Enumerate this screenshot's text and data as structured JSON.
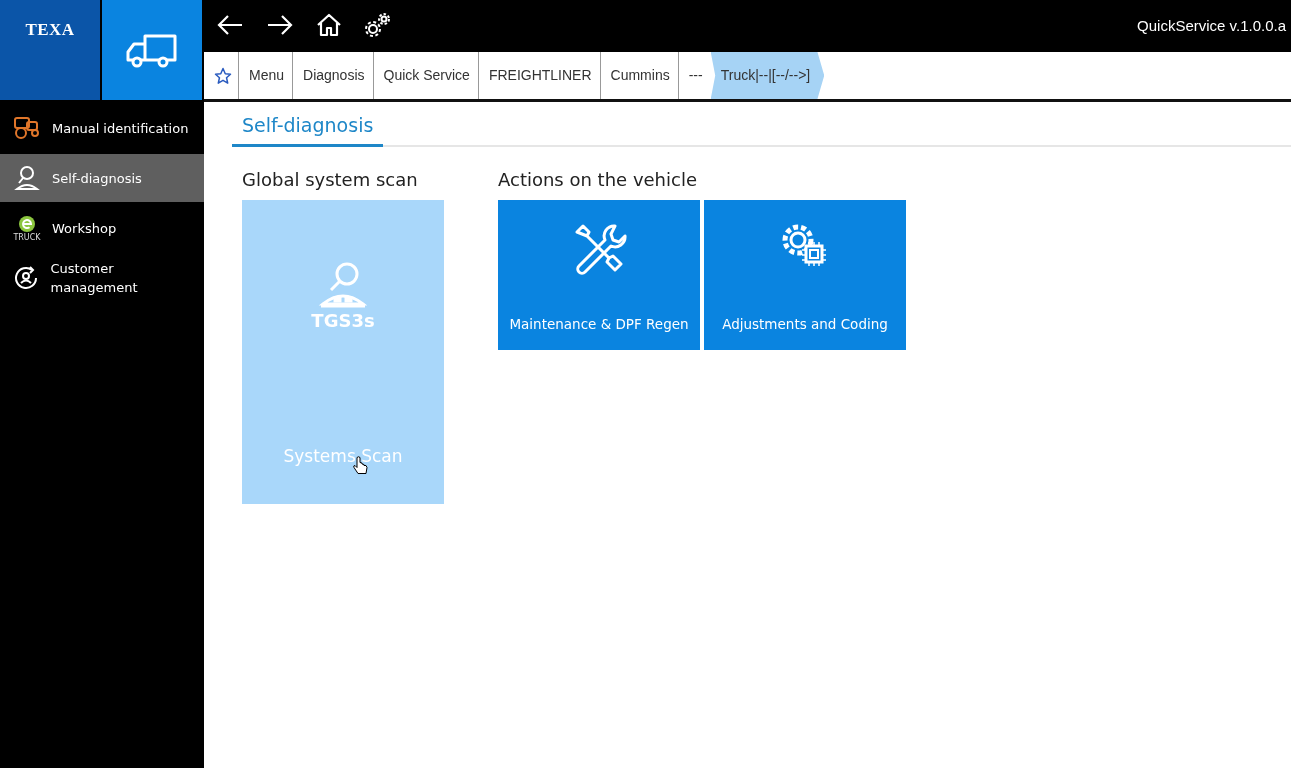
{
  "logo": {
    "text": "TEXA"
  },
  "app_title": "QuickService v.1.0.0.a",
  "breadcrumb": [
    {
      "label": "Menu",
      "selected": false
    },
    {
      "label": "Diagnosis",
      "selected": false
    },
    {
      "label": "Quick Service",
      "selected": false
    },
    {
      "label": "FREIGHTLINER",
      "selected": false
    },
    {
      "label": "Cummins",
      "selected": false
    },
    {
      "label": "---",
      "selected": false
    },
    {
      "label": "Truck|--|[--/-->]",
      "selected": true
    }
  ],
  "sidebar": {
    "items": [
      {
        "label": "Manual identification",
        "selected": false
      },
      {
        "label": "Self-diagnosis",
        "selected": true
      },
      {
        "label": "Workshop",
        "selected": false,
        "icon_caption": "TRUCK"
      },
      {
        "label": "Customer management",
        "selected": false
      }
    ]
  },
  "tabs": [
    {
      "label": "Self-diagnosis",
      "selected": true
    }
  ],
  "sections": [
    {
      "title": "Global system scan",
      "tiles": [
        {
          "label": "Systems Scan",
          "badge": "TGS3s",
          "highlighted": true
        }
      ]
    },
    {
      "title": "Actions on the vehicle",
      "tiles": [
        {
          "label": "Maintenance & DPF Regen",
          "highlighted": false
        },
        {
          "label": "Adjustments and Coding",
          "highlighted": false
        }
      ]
    }
  ]
}
